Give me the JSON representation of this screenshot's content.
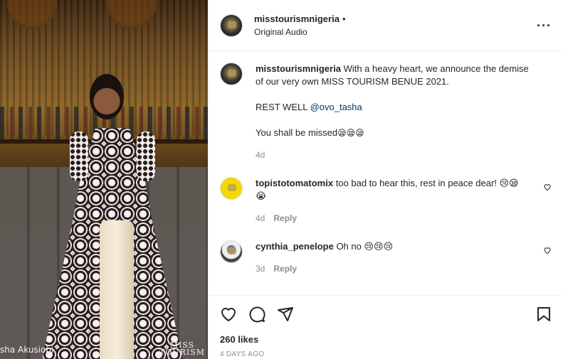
{
  "photo": {
    "watermark_left": "sha Akusiobi",
    "brand_line1": "MISS",
    "brand_line2": "TOURISM"
  },
  "header": {
    "username": "misstourismnigeria",
    "separator": "•",
    "audio_label": "Original Audio",
    "more_icon": "ellipsis-icon"
  },
  "caption": {
    "username": "misstourismnigeria",
    "text": "With a heavy heart, we announce the demise of our very own MISS TOURISM BENUE 2021.",
    "line2_prefix": "REST WELL ",
    "mention": "@ovo_tasha",
    "line3": "You shall be missed",
    "line3_emoji": "😪😪😪",
    "time": "4d"
  },
  "comments": [
    {
      "username": "topistotomatomix",
      "text": "too bad to hear this, rest in peace dear! 😢😪",
      "emoji_extra": "😭",
      "time": "4d",
      "reply_label": "Reply"
    },
    {
      "username": "cynthia_penelope",
      "text": "Oh no 😢😢😢",
      "time": "3d",
      "reply_label": "Reply"
    }
  ],
  "actions": {
    "likes": "260 likes",
    "timestamp": "4 DAYS AGO"
  },
  "colors": {
    "mention": "#00376b",
    "muted": "#8e8e8e",
    "text": "#262626"
  }
}
